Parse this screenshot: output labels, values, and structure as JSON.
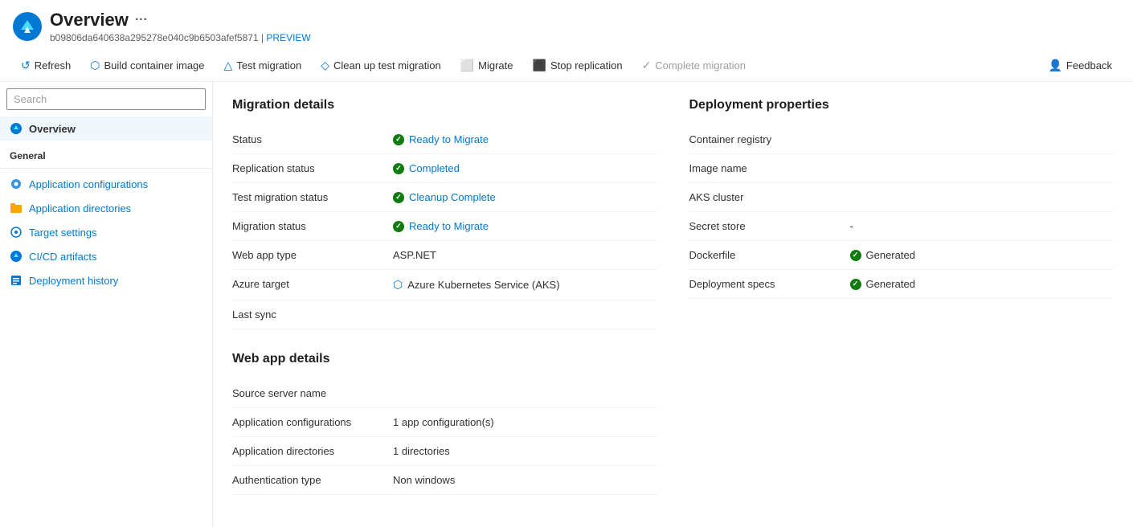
{
  "header": {
    "title": "Overview",
    "more_label": "···",
    "subtitle": "b09806da640638a295278e040c9b6503afef5871",
    "preview_label": "PREVIEW"
  },
  "toolbar": {
    "refresh": "Refresh",
    "build_container_image": "Build container image",
    "test_migration": "Test migration",
    "clean_up_test_migration": "Clean up test migration",
    "migrate": "Migrate",
    "stop_replication": "Stop replication",
    "complete_migration": "Complete migration",
    "feedback": "Feedback"
  },
  "sidebar": {
    "search_placeholder": "Search",
    "overview_label": "Overview",
    "general_label": "General",
    "items": [
      {
        "id": "app-configs",
        "label": "Application configurations"
      },
      {
        "id": "app-dirs",
        "label": "Application directories"
      },
      {
        "id": "target-settings",
        "label": "Target settings"
      },
      {
        "id": "cicd",
        "label": "CI/CD artifacts"
      },
      {
        "id": "deploy-history",
        "label": "Deployment history"
      }
    ]
  },
  "migration_details": {
    "section_title": "Migration details",
    "rows": [
      {
        "label": "Status",
        "value": "Ready to Migrate",
        "type": "status-link"
      },
      {
        "label": "Replication status",
        "value": "Completed",
        "type": "status-link"
      },
      {
        "label": "Test migration status",
        "value": "Cleanup Complete",
        "type": "status-link"
      },
      {
        "label": "Migration status",
        "value": "Ready to Migrate",
        "type": "status-link"
      },
      {
        "label": "Web app type",
        "value": "ASP.NET",
        "type": "text"
      },
      {
        "label": "Azure target",
        "value": "Azure Kubernetes Service (AKS)",
        "type": "aks"
      },
      {
        "label": "Last sync",
        "value": "",
        "type": "text"
      }
    ]
  },
  "deployment_properties": {
    "section_title": "Deployment properties",
    "rows": [
      {
        "label": "Container registry",
        "value": "",
        "type": "text"
      },
      {
        "label": "Image name",
        "value": "",
        "type": "text"
      },
      {
        "label": "AKS cluster",
        "value": "",
        "type": "text"
      },
      {
        "label": "Secret store",
        "value": "-",
        "type": "text"
      },
      {
        "label": "Dockerfile",
        "value": "Generated",
        "type": "status-text"
      },
      {
        "label": "Deployment specs",
        "value": "Generated",
        "type": "status-text"
      }
    ]
  },
  "web_app_details": {
    "section_title": "Web app details",
    "rows": [
      {
        "label": "Source server name",
        "value": "",
        "type": "text"
      },
      {
        "label": "Application configurations",
        "value": "1 app configuration(s)",
        "type": "text"
      },
      {
        "label": "Application directories",
        "value": "1 directories",
        "type": "text"
      },
      {
        "label": "Authentication type",
        "value": "Non windows",
        "type": "text"
      }
    ]
  },
  "icons": {
    "overview": "☁",
    "app_configs": "⚙",
    "app_dirs": "📁",
    "target_settings": "◎",
    "cicd": "☁",
    "deploy_history": "📦",
    "refresh": "↺",
    "build": "🔧",
    "test": "🧪",
    "cleanup": "🗑",
    "migrate": "⬜",
    "stop": "⬛",
    "complete": "✓",
    "feedback": "👤"
  }
}
